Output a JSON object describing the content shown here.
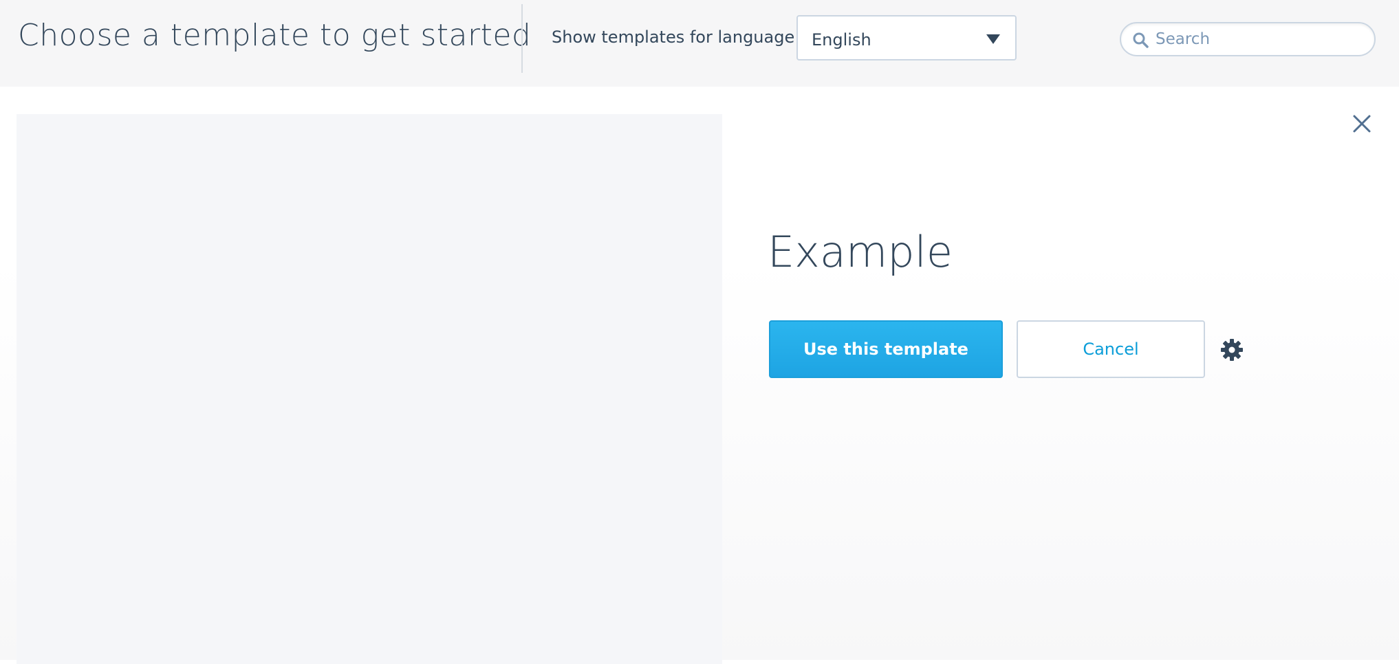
{
  "header": {
    "title": "Choose a template to get started",
    "language_label": "Show templates for language",
    "language_select": {
      "selected": "English",
      "icon": "caret-down-icon"
    },
    "search": {
      "placeholder": "Search",
      "value": "",
      "icon": "search-icon"
    }
  },
  "detail": {
    "template_name": "Example",
    "use_button_label": "Use this template",
    "cancel_button_label": "Cancel",
    "settings_icon": "gear-icon",
    "close_icon": "close-icon"
  },
  "colors": {
    "primary": "#1ea4e3",
    "link": "#0b9dd8",
    "text": "#33475b",
    "header_bg": "#f6f6f7",
    "preview_bg": "#f5f6f9"
  }
}
